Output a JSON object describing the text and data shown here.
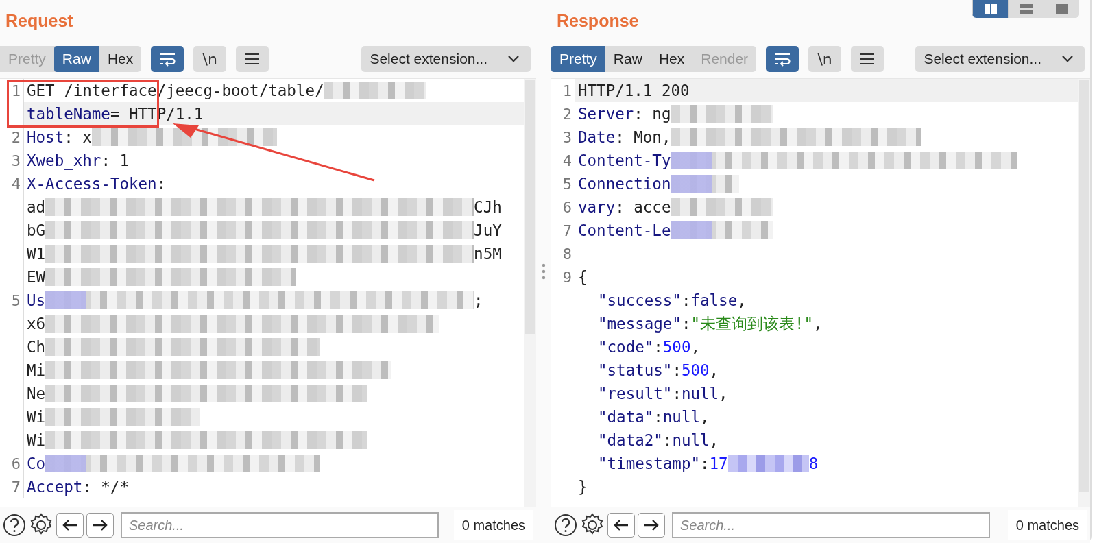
{
  "panels": [
    {
      "title": "Request",
      "tabs": [
        {
          "label": "Pretty",
          "selected": false,
          "disabled": true
        },
        {
          "label": "Raw",
          "selected": true,
          "disabled": false
        },
        {
          "label": "Hex",
          "selected": false,
          "disabled": false
        }
      ],
      "wrap_on": true,
      "newline_label": "\\n",
      "extension_select": "Select extension...",
      "rows": [
        {
          "number": "1",
          "current": false,
          "parts": [
            {
              "kind": "plain",
              "text": "GET /interface/jeecg-boot/table/"
            },
            {
              "kind": "blur_medium_grey"
            }
          ]
        },
        {
          "current": true,
          "parts": [
            {
              "kind": "key",
              "text": "tableName"
            },
            {
              "kind": "plain",
              "text": "= HTTP/1.1"
            }
          ]
        },
        {
          "number": "2",
          "current": false,
          "parts": [
            {
              "kind": "key",
              "text": "Host"
            },
            {
              "kind": "plain",
              "text": ": x"
            },
            {
              "kind": "blur_large_grey"
            }
          ]
        },
        {
          "number": "3",
          "current": false,
          "parts": [
            {
              "kind": "key",
              "text": "Xweb_xhr"
            },
            {
              "kind": "plain",
              "text": ": 1"
            }
          ]
        },
        {
          "number": "4",
          "current": false,
          "parts": [
            {
              "kind": "key",
              "text": "X-Access-Token"
            },
            {
              "kind": "plain",
              "text": ":"
            }
          ]
        },
        {
          "current": false,
          "parts": [
            {
              "kind": "plain",
              "text": "ad"
            },
            {
              "kind": "blur_full_grey"
            },
            {
              "kind": "plain",
              "text": "CJh"
            }
          ]
        },
        {
          "current": false,
          "parts": [
            {
              "kind": "plain",
              "text": "bG"
            },
            {
              "kind": "blur_full_grey"
            },
            {
              "kind": "plain",
              "text": "JuY"
            }
          ]
        },
        {
          "current": false,
          "parts": [
            {
              "kind": "plain",
              "text": "W1"
            },
            {
              "kind": "blur_full_grey"
            },
            {
              "kind": "plain",
              "text": "n5M"
            }
          ]
        },
        {
          "current": false,
          "parts": [
            {
              "kind": "plain",
              "text": "EW"
            },
            {
              "kind": "blur_huge_grey"
            }
          ]
        },
        {
          "number": "5",
          "current": false,
          "parts": [
            {
              "kind": "key",
              "text": "Us"
            },
            {
              "kind": "blur_full_mixed"
            },
            {
              "kind": "plain",
              "text": ";"
            }
          ]
        },
        {
          "current": false,
          "parts": [
            {
              "kind": "plain",
              "text": "x6"
            },
            {
              "kind": "blur_vast_grey"
            }
          ]
        },
        {
          "current": false,
          "parts": [
            {
              "kind": "plain",
              "text": "Ch"
            },
            {
              "kind": "blur_big_grey"
            }
          ]
        },
        {
          "current": false,
          "parts": [
            {
              "kind": "plain",
              "text": "Mi"
            },
            {
              "kind": "blur_longer_grey"
            }
          ]
        },
        {
          "current": false,
          "parts": [
            {
              "kind": "plain",
              "text": "Ne"
            },
            {
              "kind": "blur_long_grey"
            }
          ]
        },
        {
          "current": false,
          "parts": [
            {
              "kind": "plain",
              "text": "Wi"
            },
            {
              "kind": "blur_wide_grey"
            }
          ]
        },
        {
          "current": false,
          "parts": [
            {
              "kind": "plain",
              "text": "Wi"
            },
            {
              "kind": "blur_long_grey"
            }
          ]
        },
        {
          "number": "6",
          "current": false,
          "parts": [
            {
              "kind": "key",
              "text": "Co"
            },
            {
              "kind": "blur_big_mixed"
            }
          ]
        },
        {
          "number": "7",
          "current": false,
          "parts": [
            {
              "kind": "key",
              "text": "Accept"
            },
            {
              "kind": "plain",
              "text": ": */*"
            }
          ]
        }
      ],
      "highlight_box": true,
      "pointer_arrow": true,
      "search": {
        "placeholder": "Search..."
      },
      "matches": "0 matches"
    },
    {
      "title": "Response",
      "tabs": [
        {
          "label": "Pretty",
          "selected": true,
          "disabled": false
        },
        {
          "label": "Raw",
          "selected": false,
          "disabled": false
        },
        {
          "label": "Hex",
          "selected": false,
          "disabled": false
        },
        {
          "label": "Render",
          "selected": false,
          "disabled": true
        }
      ],
      "layout_buttons": [
        {
          "kind": "columns",
          "selected": true
        },
        {
          "kind": "rows",
          "selected": false
        },
        {
          "kind": "single",
          "selected": false
        }
      ],
      "wrap_on": true,
      "newline_label": "\\n",
      "extension_select": "Select extension...",
      "rows": [
        {
          "number": "1",
          "current": true,
          "parts": [
            {
              "kind": "plain",
              "text": "HTTP/1.1 200"
            }
          ]
        },
        {
          "number": "2",
          "current": false,
          "parts": [
            {
              "kind": "key",
              "text": "Server"
            },
            {
              "kind": "plain",
              "text": ": ng"
            },
            {
              "kind": "blur_medium_grey"
            }
          ]
        },
        {
          "number": "3",
          "current": false,
          "parts": [
            {
              "kind": "key",
              "text": "Date"
            },
            {
              "kind": "plain",
              "text": ": Mon,"
            },
            {
              "kind": "blur_huge_grey"
            }
          ]
        },
        {
          "number": "4",
          "current": false,
          "parts": [
            {
              "kind": "key",
              "text": "Content-Ty"
            },
            {
              "kind": "blur_longer_mixed"
            }
          ]
        },
        {
          "number": "5",
          "current": false,
          "parts": [
            {
              "kind": "key",
              "text": "Connection"
            },
            {
              "kind": "blur_small_mixed"
            }
          ]
        },
        {
          "number": "6",
          "current": false,
          "parts": [
            {
              "kind": "key",
              "text": "vary"
            },
            {
              "kind": "plain",
              "text": ": acce"
            },
            {
              "kind": "blur_medium_grey"
            }
          ]
        },
        {
          "number": "7",
          "current": false,
          "parts": [
            {
              "kind": "key",
              "text": "Content-Le"
            },
            {
              "kind": "blur_medium_mixed"
            }
          ]
        },
        {
          "number": "8",
          "current": false,
          "parts": []
        },
        {
          "number": "9",
          "current": false,
          "parts": [
            {
              "kind": "plain",
              "text": "{"
            }
          ]
        },
        {
          "current": false,
          "indent": true,
          "parts": [
            {
              "kind": "key",
              "text": "\"success\""
            },
            {
              "kind": "plain",
              "text": ":"
            },
            {
              "kind": "key",
              "text": "false"
            },
            {
              "kind": "plain",
              "text": ","
            }
          ]
        },
        {
          "current": false,
          "indent": true,
          "parts": [
            {
              "kind": "key",
              "text": "\"message\""
            },
            {
              "kind": "plain",
              "text": ":"
            },
            {
              "kind": "string",
              "text": "\"未查询到该表!\""
            },
            {
              "kind": "plain",
              "text": ","
            }
          ]
        },
        {
          "current": false,
          "indent": true,
          "parts": [
            {
              "kind": "key",
              "text": "\"code\""
            },
            {
              "kind": "plain",
              "text": ":"
            },
            {
              "kind": "number",
              "text": "500"
            },
            {
              "kind": "plain",
              "text": ","
            }
          ]
        },
        {
          "current": false,
          "indent": true,
          "parts": [
            {
              "kind": "key",
              "text": "\"status\""
            },
            {
              "kind": "plain",
              "text": ":"
            },
            {
              "kind": "number",
              "text": "500"
            },
            {
              "kind": "plain",
              "text": ","
            }
          ]
        },
        {
          "current": false,
          "indent": true,
          "parts": [
            {
              "kind": "key",
              "text": "\"result\""
            },
            {
              "kind": "plain",
              "text": ":"
            },
            {
              "kind": "key",
              "text": "null"
            },
            {
              "kind": "plain",
              "text": ","
            }
          ]
        },
        {
          "current": false,
          "indent": true,
          "parts": [
            {
              "kind": "key",
              "text": "\"data\""
            },
            {
              "kind": "plain",
              "text": ":"
            },
            {
              "kind": "key",
              "text": "null"
            },
            {
              "kind": "plain",
              "text": ","
            }
          ]
        },
        {
          "current": false,
          "indent": true,
          "parts": [
            {
              "kind": "key",
              "text": "\"data2\""
            },
            {
              "kind": "plain",
              "text": ":"
            },
            {
              "kind": "key",
              "text": "null"
            },
            {
              "kind": "plain",
              "text": ","
            }
          ]
        },
        {
          "current": false,
          "indent": true,
          "parts": [
            {
              "kind": "key",
              "text": "\"timestamp\""
            },
            {
              "kind": "plain",
              "text": ":"
            },
            {
              "kind": "number",
              "text": "17"
            },
            {
              "kind": "blur_narrow_blue"
            },
            {
              "kind": "number",
              "text": "8"
            }
          ]
        },
        {
          "current": false,
          "parts": [
            {
              "kind": "plain",
              "text": "}"
            }
          ]
        }
      ],
      "search": {
        "placeholder": "Search..."
      },
      "matches": "0 matches"
    }
  ]
}
